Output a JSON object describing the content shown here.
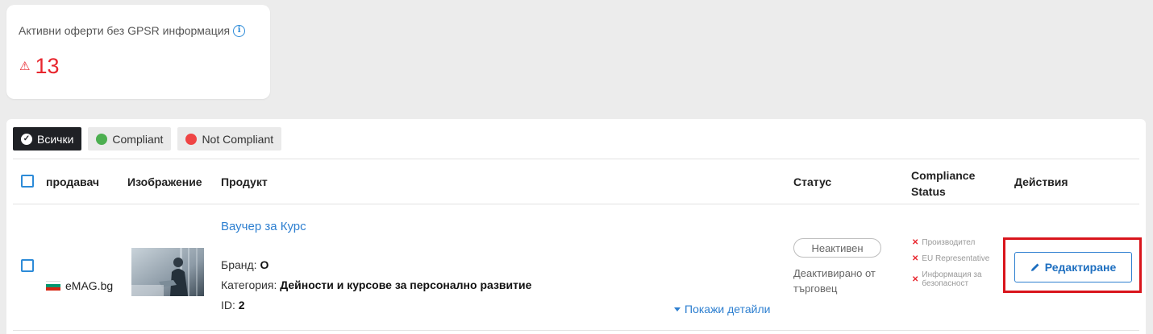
{
  "stat_card": {
    "title": "Активни оферти без GPSR информация",
    "info_icon": "info-icon",
    "warning_icon": "⚠",
    "value": "13"
  },
  "filters": [
    {
      "label": "Всички",
      "icon": "check-circle-icon",
      "active": true
    },
    {
      "label": "Compliant",
      "icon": "green-dot-icon",
      "color": "#4caf50"
    },
    {
      "label": "Not Compliant",
      "icon": "red-dot-icon",
      "color": "#ef4444"
    }
  ],
  "table": {
    "headers": {
      "seller": "продавач",
      "image": "Изображение",
      "product": "Продукт",
      "status": "Статус",
      "compliance_line1": "Compliance",
      "compliance_line2": "Status",
      "actions": "Действия"
    },
    "rows": [
      {
        "seller": "eMAG.bg",
        "seller_flag": "bulgaria-flag",
        "product_title": "Ваучер за Курс",
        "brand_label": "Бранд:",
        "brand_value": "O",
        "category_label": "Категория:",
        "category_value": "Дейности и курсове за персонално развитие",
        "id_label": "ID:",
        "id_value": "2",
        "details_link": "Покажи детайли",
        "status_pill": "Неактивен",
        "status_sub": "Деактивирано от търговец",
        "compliance_issues": [
          "Производител",
          "EU Representative",
          "Информация за безопасност"
        ],
        "edit_button": "Редактиране"
      }
    ]
  },
  "colors": {
    "accent": "#2d7fd0",
    "danger": "#e8262e",
    "highlight_frame": "#d9151c",
    "compliant": "#4caf50",
    "not_compliant": "#ef4444"
  }
}
